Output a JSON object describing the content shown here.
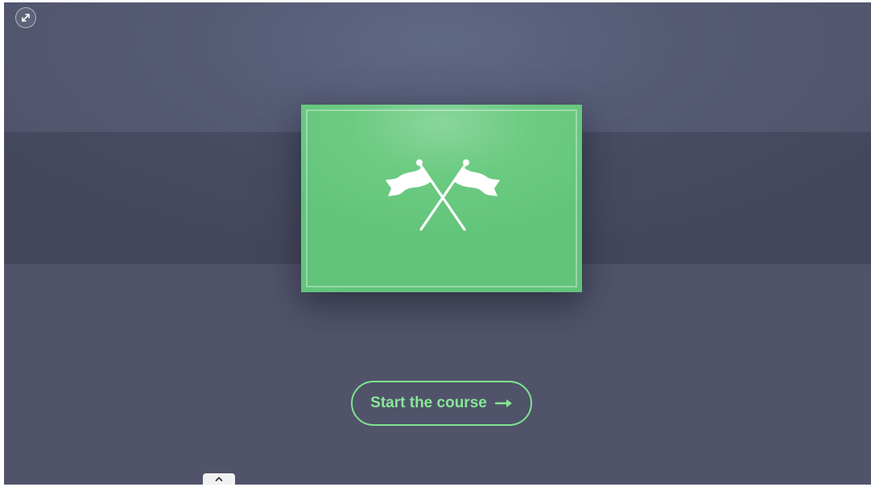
{
  "toolbar": {
    "expand_icon": "expand-arrows-icon"
  },
  "cover": {
    "icon": "crossed-flags-icon",
    "accent_color": "#6ccb82"
  },
  "start": {
    "label": "Start the course",
    "arrow_icon": "arrow-right-icon",
    "color": "#86e895"
  },
  "footer": {
    "collapse_icon": "chevron-up-icon"
  }
}
